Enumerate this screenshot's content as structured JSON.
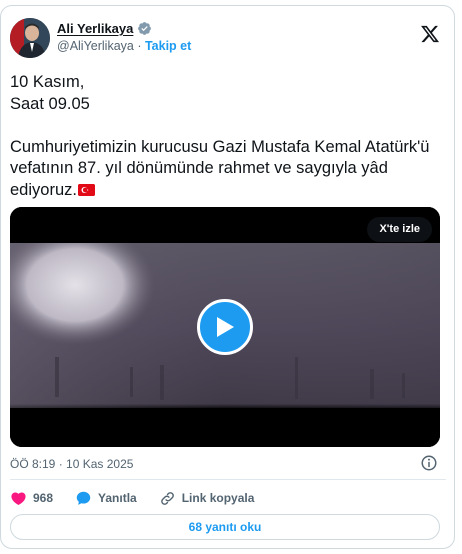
{
  "author": {
    "name": "Ali Yerlikaya",
    "handle": "@AliYerlikaya",
    "separator": " · ",
    "follow_label": "Takip et"
  },
  "post": {
    "text": "10 Kasım,\nSaat 09.05\n\nCumhuriyetimizin kurucusu Gazi Mustafa Kemal Atatürk'ü vefatının 87. yıl dönümünde rahmet ve saygıyla yâd ediyoruz.",
    "emoji": "turkish-flag"
  },
  "video": {
    "watch_label": "X'te izle"
  },
  "meta": {
    "time": "ÖÖ 8:19",
    "separator": " · ",
    "date": "10 Kas 2025"
  },
  "actions": {
    "likes": "968",
    "reply_label": "Yanıtla",
    "copy_link_label": "Link kopyala"
  },
  "replies_button": "68 yanıtı oku",
  "colors": {
    "accent": "#1d9bf0",
    "like": "#f91880",
    "text": "#0f1419",
    "muted": "#536471"
  }
}
